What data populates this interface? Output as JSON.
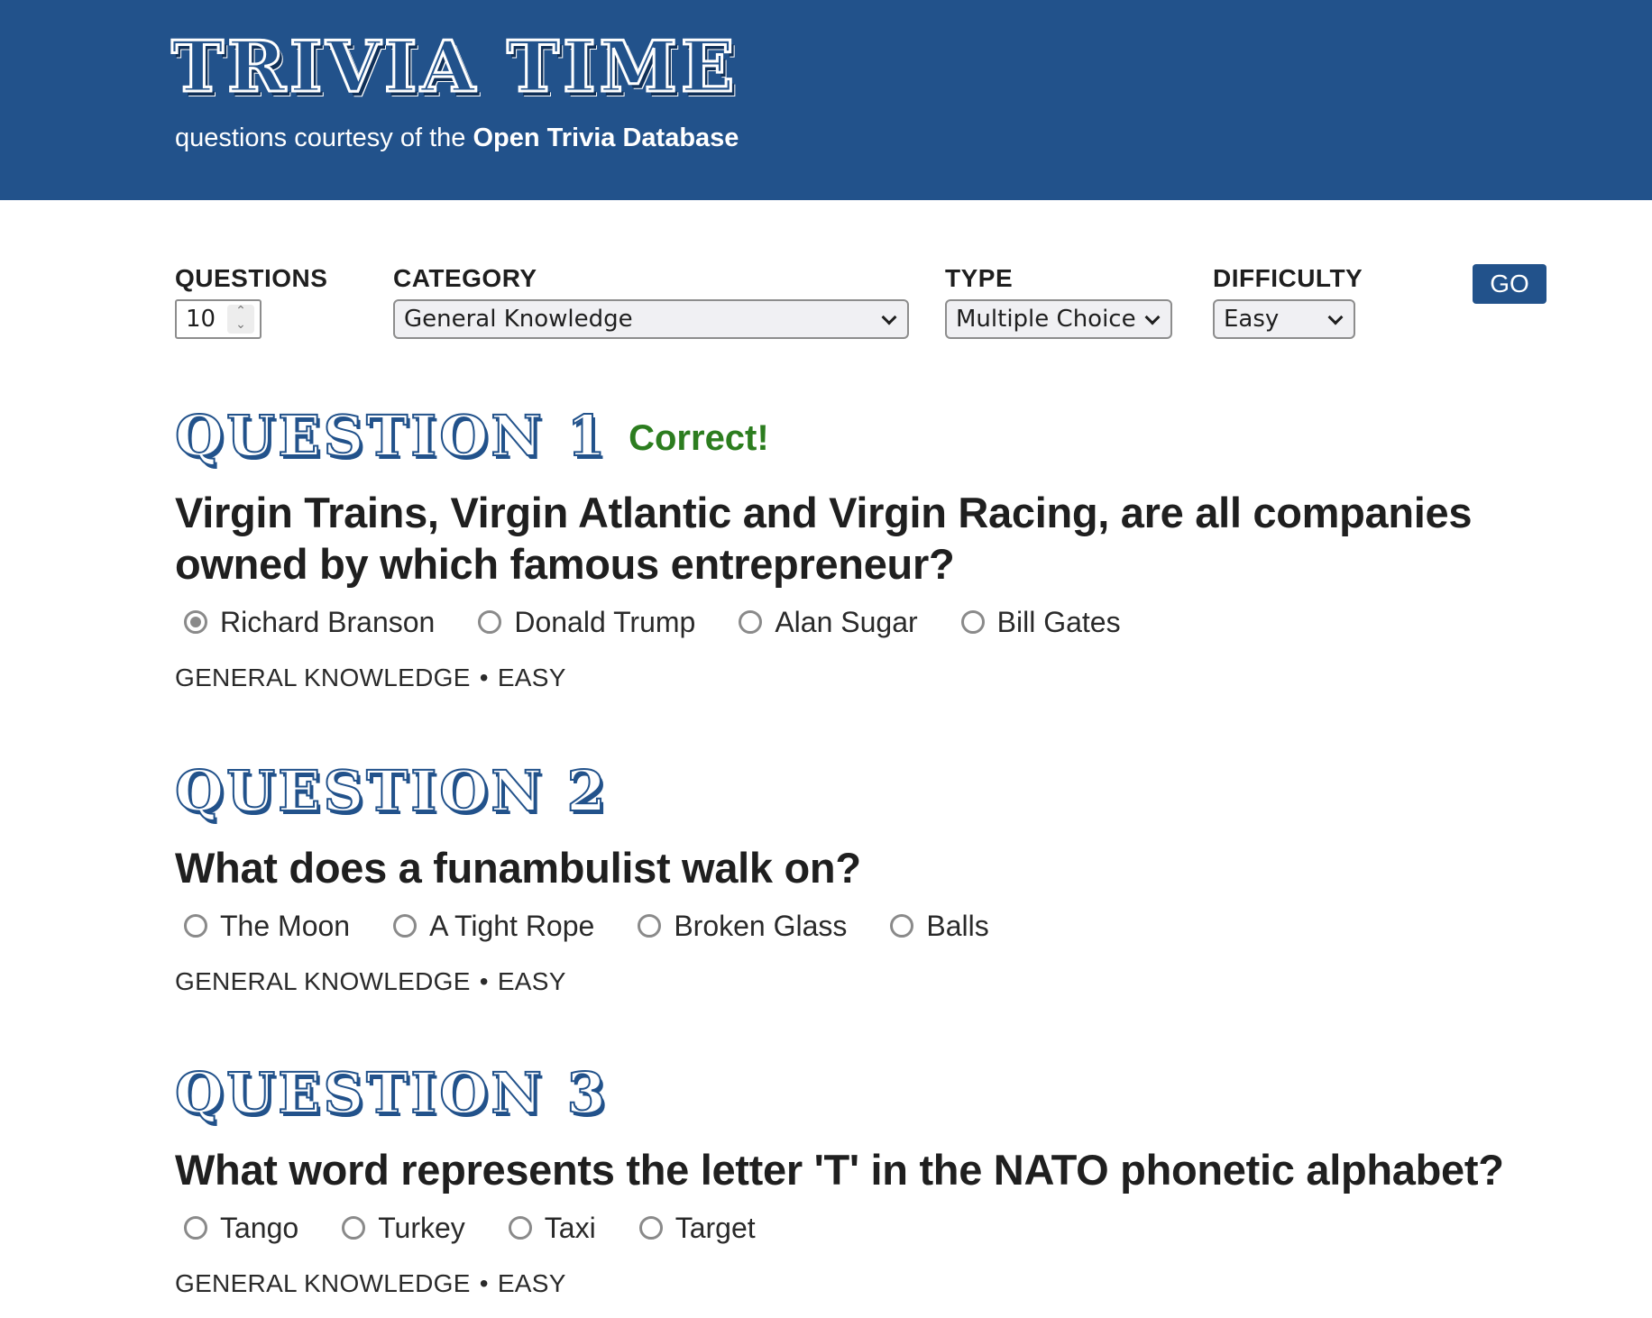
{
  "header": {
    "title": "TRIVIA TIME",
    "subtitle_prefix": "questions courtesy of the ",
    "subtitle_link": "Open Trivia Database"
  },
  "controls": {
    "questions": {
      "label": "QUESTIONS",
      "value": "10"
    },
    "category": {
      "label": "CATEGORY",
      "value": "General Knowledge"
    },
    "type": {
      "label": "TYPE",
      "value": "Multiple Choice"
    },
    "difficulty": {
      "label": "DIFFICULTY",
      "value": "Easy"
    },
    "go_label": "GO"
  },
  "questions": [
    {
      "title": "QUESTION 1",
      "result": "Correct!",
      "text": "Virgin Trains, Virgin Atlantic and Virgin Racing, are all companies owned by which famous entrepreneur?",
      "options": [
        "Richard Branson",
        "Donald Trump",
        "Alan Sugar",
        "Bill Gates"
      ],
      "selected": 0,
      "category": "GENERAL KNOWLEDGE",
      "difficulty": "EASY"
    },
    {
      "title": "QUESTION 2",
      "result": "",
      "text": "What does a funambulist walk on?",
      "options": [
        "The Moon",
        "A Tight Rope",
        "Broken Glass",
        "Balls"
      ],
      "selected": -1,
      "category": "GENERAL KNOWLEDGE",
      "difficulty": "EASY"
    },
    {
      "title": "QUESTION 3",
      "result": "",
      "text": "What word represents the letter 'T' in the NATO phonetic alphabet?",
      "options": [
        "Tango",
        "Turkey",
        "Taxi",
        "Target"
      ],
      "selected": -1,
      "category": "GENERAL KNOWLEDGE",
      "difficulty": "EASY"
    }
  ],
  "meta_separator": "•",
  "colors": {
    "brand": "#22528b",
    "correct": "#2c7d1f"
  }
}
